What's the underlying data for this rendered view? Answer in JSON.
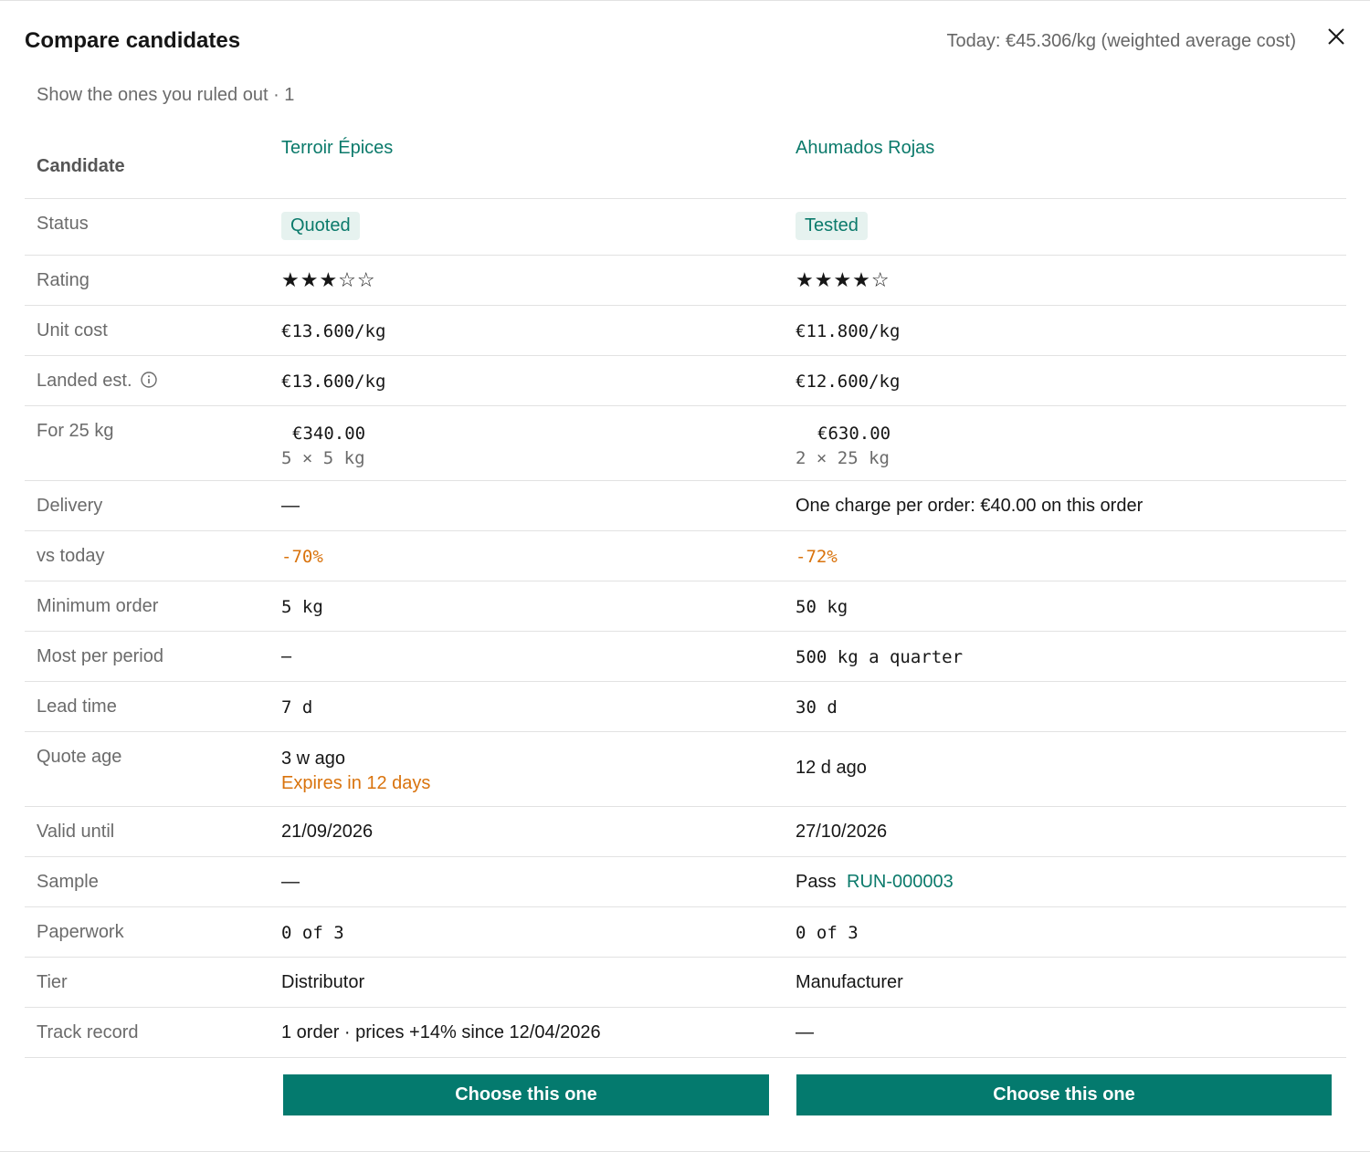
{
  "header": {
    "title": "Compare candidates",
    "today": "Today: €45.306/kg (weighted average cost)",
    "ruled_out": "Show the ones you ruled out · 1"
  },
  "icons": {
    "close": "close-icon",
    "info": "info-icon"
  },
  "colors": {
    "accent": "#047a6e",
    "link": "#0b7a6b",
    "warning": "#d9730d",
    "badge_bg": "#e6f2ef"
  },
  "labels": {
    "candidate": "Candidate",
    "status": "Status",
    "rating": "Rating",
    "unit_cost": "Unit cost",
    "landed": "Landed est.",
    "for_qty": "For 25 kg",
    "delivery": "Delivery",
    "vs_today": "vs today",
    "min_order": "Minimum order",
    "most_per_period": "Most per period",
    "lead_time": "Lead time",
    "quote_age": "Quote age",
    "valid_until": "Valid until",
    "sample": "Sample",
    "paperwork": "Paperwork",
    "tier": "Tier",
    "track_record": "Track record"
  },
  "candidates": [
    {
      "name": "Terroir Épices",
      "status": "Quoted",
      "rating": 3,
      "rating_text": "★★★☆☆",
      "unit_cost": "€13.600/kg",
      "landed": "€13.600/kg",
      "for_qty_total": "€340.00",
      "for_qty_packs": "5 × 5 kg",
      "delivery": "—",
      "vs_today": "-70%",
      "min_order": "5 kg",
      "most_per_period": "–",
      "lead_time": "7 d",
      "quote_age": "3 w ago",
      "quote_expiry": "Expires in 12 days",
      "valid_until": "21/09/2026",
      "sample_status": "—",
      "sample_run": "",
      "paperwork": "0 of 3",
      "tier": "Distributor",
      "track_record": "1 order · prices +14% since 12/04/2026",
      "choose": "Choose this one"
    },
    {
      "name": "Ahumados Rojas",
      "status": "Tested",
      "rating": 4,
      "rating_text": "★★★★☆",
      "unit_cost": "€11.800/kg",
      "landed": "€12.600/kg",
      "for_qty_total": "€630.00",
      "for_qty_packs": "2 × 25 kg",
      "delivery": "One charge per order: €40.00 on this order",
      "vs_today": "-72%",
      "min_order": "50 kg",
      "most_per_period": "500 kg a quarter",
      "lead_time": "30 d",
      "quote_age": "12 d ago",
      "quote_expiry": "",
      "valid_until": "27/10/2026",
      "sample_status": "Pass",
      "sample_run": "RUN-000003",
      "paperwork": "0 of 3",
      "tier": "Manufacturer",
      "track_record": "—",
      "choose": "Choose this one"
    }
  ]
}
